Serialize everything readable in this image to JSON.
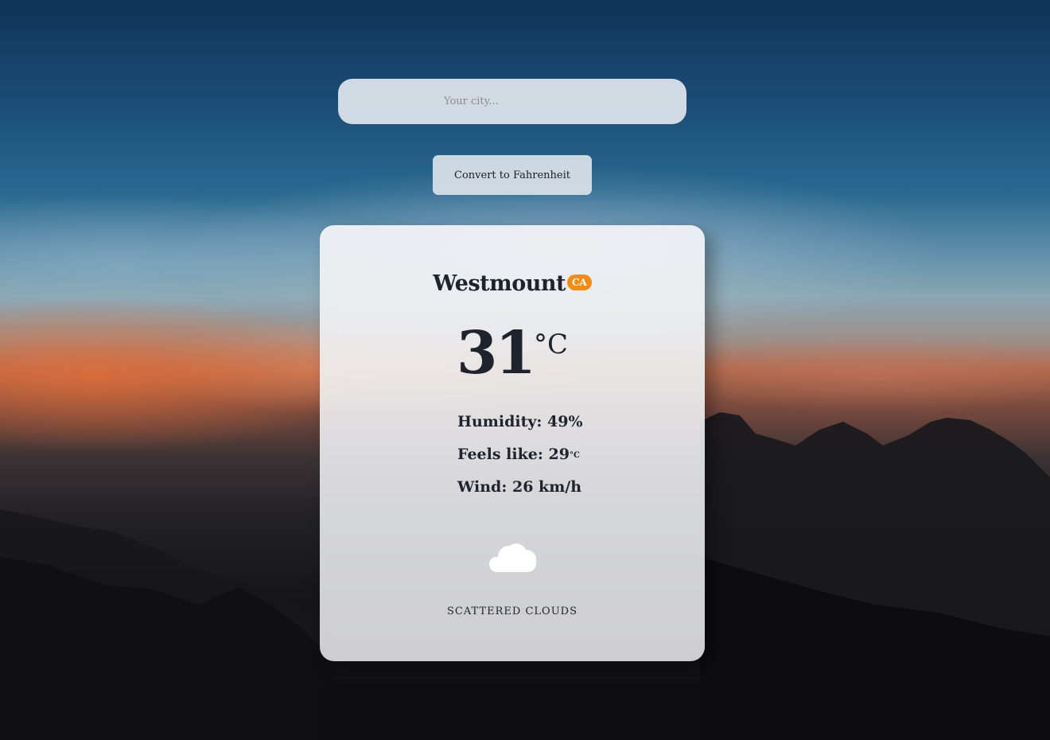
{
  "search": {
    "placeholder": "Your city...",
    "value": ""
  },
  "convert_button": {
    "label": "Convert to Fahrenheit"
  },
  "weather": {
    "city": "Westmount",
    "country": "CA",
    "temperature": "31",
    "temperature_unit": "°C",
    "humidity_label": "Humidity:",
    "humidity_value": "49%",
    "feels_like_label": "Feels like:",
    "feels_like_value": "29",
    "feels_like_unit": "°C",
    "wind_label": "Wind:",
    "wind_value": "26 km/h",
    "icon": "cloud-icon",
    "condition": "SCATTERED CLOUDS"
  },
  "colors": {
    "badge": "#f28d13",
    "text": "#1f232d",
    "card": "#ececef"
  }
}
